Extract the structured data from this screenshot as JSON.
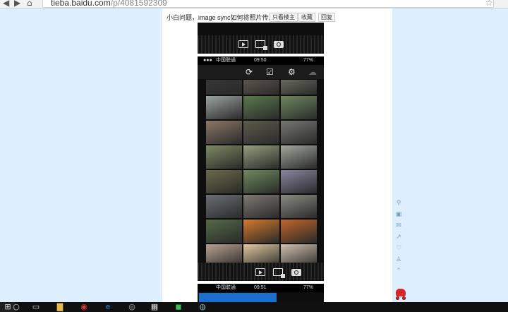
{
  "browser": {
    "url_domain": "tieba.baidu.com",
    "url_path": "/p/4081592309",
    "back_icon": "back-arrow",
    "forward_icon": "forward-arrow",
    "home_icon": "home",
    "star_icon": "star"
  },
  "post": {
    "title": "小白问题，image sync如何将照片传...",
    "buttons": [
      "只看楼主",
      "收藏",
      "回复"
    ]
  },
  "screenshots": [
    {
      "name": "shot-top"
    },
    {
      "name": "shot-gallery",
      "carrier": "中国联通",
      "time": "09:50",
      "battery": "77%",
      "toolbar_icons": [
        "sync-icon",
        "select-icon",
        "settings-icon",
        "cloud-off-icon"
      ],
      "bottom_icons": [
        "slideshow-icon",
        "select-icon",
        "camera-icon"
      ],
      "thumbs": [
        [
          "#3a3a3a",
          "#6b6156",
          "#7a7d6a"
        ],
        [
          "#9aa4a0",
          "#5a7a4e",
          "#6f8760"
        ],
        [
          "#8c7868",
          "#5e5a4e",
          "#777773"
        ],
        [
          "#7d8a63",
          "#93a07e",
          "#a0a89c"
        ],
        [
          "#6c6a4a",
          "#6f8a5c",
          "#8a85a0"
        ],
        [
          "#6a6f75",
          "#7e7a72",
          "#8a8c82"
        ],
        [
          "#556a48",
          "#d47a2a",
          "#c2652a"
        ],
        [
          "#b8a090",
          "#e0c8a0",
          "#d0c0b0"
        ]
      ]
    },
    {
      "name": "shot-bottom",
      "carrier": "中国联通",
      "time": "09:51",
      "battery": "77%"
    }
  ],
  "sidebar_icons": [
    "location-icon",
    "gift-icon",
    "mail-icon",
    "share-icon",
    "heart-icon",
    "user-icon",
    "up-arrow-icon"
  ],
  "taskbar_icons": [
    "search-icon",
    "task-view-icon",
    "file-explorer-icon",
    "chrome-icon",
    "edge-icon",
    "app-icon",
    "store-icon",
    "line-icon",
    "app-icon-2"
  ]
}
